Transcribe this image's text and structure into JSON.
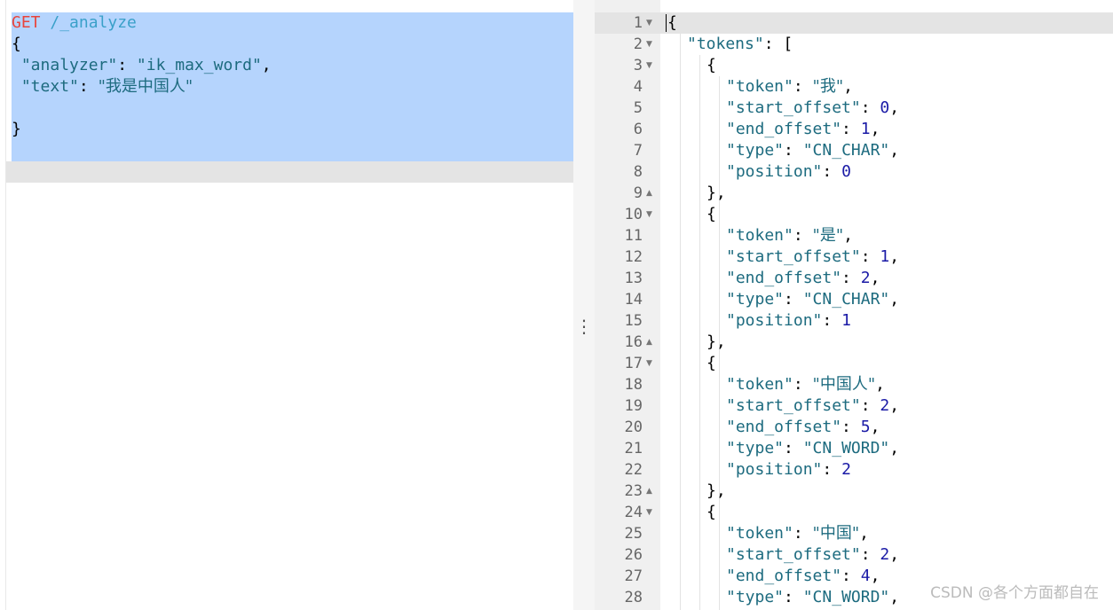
{
  "request_editor": {
    "method": "GET",
    "path": "/_analyze",
    "open_brace": "{",
    "analyzer_key": "\"analyzer\"",
    "analyzer_value": "\"ik_max_word\"",
    "text_key": "\"text\"",
    "text_value": "\"我是中国人\"",
    "close_brace": "}"
  },
  "splitter": {
    "icon": "vertical-ellipsis-icon"
  },
  "response_viewer": {
    "lines": [
      {
        "no": "1",
        "fold": "down",
        "indent": 0,
        "parts": [
          {
            "t": "{",
            "c": "p"
          }
        ]
      },
      {
        "no": "2",
        "fold": "down",
        "indent": 1,
        "parts": [
          {
            "t": "\"tokens\"",
            "c": "k"
          },
          {
            "t": ": [",
            "c": "p"
          }
        ]
      },
      {
        "no": "3",
        "fold": "down",
        "indent": 2,
        "parts": [
          {
            "t": "{",
            "c": "p"
          }
        ]
      },
      {
        "no": "4",
        "fold": "",
        "indent": 3,
        "parts": [
          {
            "t": "\"token\"",
            "c": "k"
          },
          {
            "t": ": ",
            "c": "p"
          },
          {
            "t": "\"我\"",
            "c": "s"
          },
          {
            "t": ",",
            "c": "p"
          }
        ]
      },
      {
        "no": "5",
        "fold": "",
        "indent": 3,
        "parts": [
          {
            "t": "\"start_offset\"",
            "c": "k"
          },
          {
            "t": ": ",
            "c": "p"
          },
          {
            "t": "0",
            "c": "n"
          },
          {
            "t": ",",
            "c": "p"
          }
        ]
      },
      {
        "no": "6",
        "fold": "",
        "indent": 3,
        "parts": [
          {
            "t": "\"end_offset\"",
            "c": "k"
          },
          {
            "t": ": ",
            "c": "p"
          },
          {
            "t": "1",
            "c": "n"
          },
          {
            "t": ",",
            "c": "p"
          }
        ]
      },
      {
        "no": "7",
        "fold": "",
        "indent": 3,
        "parts": [
          {
            "t": "\"type\"",
            "c": "k"
          },
          {
            "t": ": ",
            "c": "p"
          },
          {
            "t": "\"CN_CHAR\"",
            "c": "s"
          },
          {
            "t": ",",
            "c": "p"
          }
        ]
      },
      {
        "no": "8",
        "fold": "",
        "indent": 3,
        "parts": [
          {
            "t": "\"position\"",
            "c": "k"
          },
          {
            "t": ": ",
            "c": "p"
          },
          {
            "t": "0",
            "c": "n"
          }
        ]
      },
      {
        "no": "9",
        "fold": "up",
        "indent": 2,
        "parts": [
          {
            "t": "},",
            "c": "p"
          }
        ]
      },
      {
        "no": "10",
        "fold": "down",
        "indent": 2,
        "parts": [
          {
            "t": "{",
            "c": "p"
          }
        ]
      },
      {
        "no": "11",
        "fold": "",
        "indent": 3,
        "parts": [
          {
            "t": "\"token\"",
            "c": "k"
          },
          {
            "t": ": ",
            "c": "p"
          },
          {
            "t": "\"是\"",
            "c": "s"
          },
          {
            "t": ",",
            "c": "p"
          }
        ]
      },
      {
        "no": "12",
        "fold": "",
        "indent": 3,
        "parts": [
          {
            "t": "\"start_offset\"",
            "c": "k"
          },
          {
            "t": ": ",
            "c": "p"
          },
          {
            "t": "1",
            "c": "n"
          },
          {
            "t": ",",
            "c": "p"
          }
        ]
      },
      {
        "no": "13",
        "fold": "",
        "indent": 3,
        "parts": [
          {
            "t": "\"end_offset\"",
            "c": "k"
          },
          {
            "t": ": ",
            "c": "p"
          },
          {
            "t": "2",
            "c": "n"
          },
          {
            "t": ",",
            "c": "p"
          }
        ]
      },
      {
        "no": "14",
        "fold": "",
        "indent": 3,
        "parts": [
          {
            "t": "\"type\"",
            "c": "k"
          },
          {
            "t": ": ",
            "c": "p"
          },
          {
            "t": "\"CN_CHAR\"",
            "c": "s"
          },
          {
            "t": ",",
            "c": "p"
          }
        ]
      },
      {
        "no": "15",
        "fold": "",
        "indent": 3,
        "parts": [
          {
            "t": "\"position\"",
            "c": "k"
          },
          {
            "t": ": ",
            "c": "p"
          },
          {
            "t": "1",
            "c": "n"
          }
        ]
      },
      {
        "no": "16",
        "fold": "up",
        "indent": 2,
        "parts": [
          {
            "t": "},",
            "c": "p"
          }
        ]
      },
      {
        "no": "17",
        "fold": "down",
        "indent": 2,
        "parts": [
          {
            "t": "{",
            "c": "p"
          }
        ]
      },
      {
        "no": "18",
        "fold": "",
        "indent": 3,
        "parts": [
          {
            "t": "\"token\"",
            "c": "k"
          },
          {
            "t": ": ",
            "c": "p"
          },
          {
            "t": "\"中国人\"",
            "c": "s"
          },
          {
            "t": ",",
            "c": "p"
          }
        ]
      },
      {
        "no": "19",
        "fold": "",
        "indent": 3,
        "parts": [
          {
            "t": "\"start_offset\"",
            "c": "k"
          },
          {
            "t": ": ",
            "c": "p"
          },
          {
            "t": "2",
            "c": "n"
          },
          {
            "t": ",",
            "c": "p"
          }
        ]
      },
      {
        "no": "20",
        "fold": "",
        "indent": 3,
        "parts": [
          {
            "t": "\"end_offset\"",
            "c": "k"
          },
          {
            "t": ": ",
            "c": "p"
          },
          {
            "t": "5",
            "c": "n"
          },
          {
            "t": ",",
            "c": "p"
          }
        ]
      },
      {
        "no": "21",
        "fold": "",
        "indent": 3,
        "parts": [
          {
            "t": "\"type\"",
            "c": "k"
          },
          {
            "t": ": ",
            "c": "p"
          },
          {
            "t": "\"CN_WORD\"",
            "c": "s"
          },
          {
            "t": ",",
            "c": "p"
          }
        ]
      },
      {
        "no": "22",
        "fold": "",
        "indent": 3,
        "parts": [
          {
            "t": "\"position\"",
            "c": "k"
          },
          {
            "t": ": ",
            "c": "p"
          },
          {
            "t": "2",
            "c": "n"
          }
        ]
      },
      {
        "no": "23",
        "fold": "up",
        "indent": 2,
        "parts": [
          {
            "t": "},",
            "c": "p"
          }
        ]
      },
      {
        "no": "24",
        "fold": "down",
        "indent": 2,
        "parts": [
          {
            "t": "{",
            "c": "p"
          }
        ]
      },
      {
        "no": "25",
        "fold": "",
        "indent": 3,
        "parts": [
          {
            "t": "\"token\"",
            "c": "k"
          },
          {
            "t": ": ",
            "c": "p"
          },
          {
            "t": "\"中国\"",
            "c": "s"
          },
          {
            "t": ",",
            "c": "p"
          }
        ]
      },
      {
        "no": "26",
        "fold": "",
        "indent": 3,
        "parts": [
          {
            "t": "\"start_offset\"",
            "c": "k"
          },
          {
            "t": ": ",
            "c": "p"
          },
          {
            "t": "2",
            "c": "n"
          },
          {
            "t": ",",
            "c": "p"
          }
        ]
      },
      {
        "no": "27",
        "fold": "",
        "indent": 3,
        "parts": [
          {
            "t": "\"end_offset\"",
            "c": "k"
          },
          {
            "t": ": ",
            "c": "p"
          },
          {
            "t": "4",
            "c": "n"
          },
          {
            "t": ",",
            "c": "p"
          }
        ]
      },
      {
        "no": "28",
        "fold": "",
        "indent": 3,
        "parts": [
          {
            "t": "\"type\"",
            "c": "k"
          },
          {
            "t": ": ",
            "c": "p"
          },
          {
            "t": "\"CN_WORD\"",
            "c": "s"
          },
          {
            "t": ",",
            "c": "p"
          }
        ]
      }
    ]
  },
  "watermark": "CSDN @各个方面都自在",
  "colors": {
    "method": "#e8453c",
    "path": "#3aa0c9",
    "key": "#1d6b7f",
    "string": "#1d6b7f",
    "number": "#1a1aa6",
    "punctuation": "#000000",
    "selection": "#b5d4fd"
  }
}
